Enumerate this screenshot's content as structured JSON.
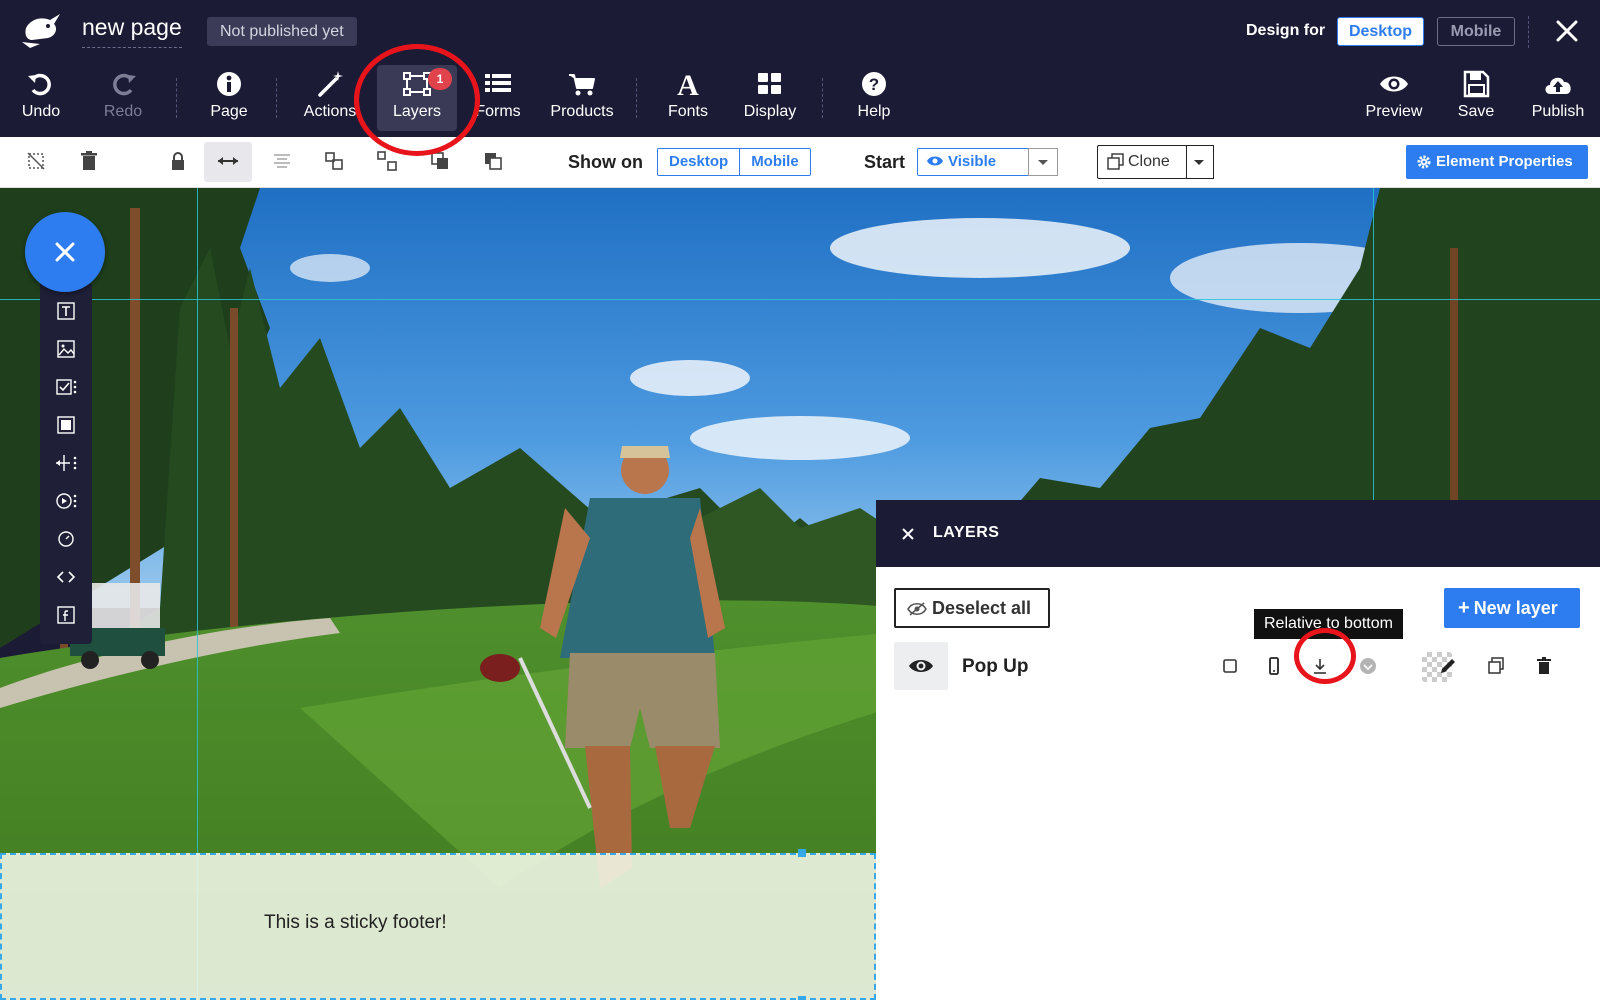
{
  "header": {
    "page_title": "new page",
    "publish_status": "Not published yet",
    "design_for_label": "Design for",
    "design_for_options": [
      "Desktop",
      "Mobile"
    ],
    "design_for_selected": "Desktop"
  },
  "toolbar": {
    "items": [
      {
        "label": "Undo",
        "icon": "undo-icon",
        "enabled": true
      },
      {
        "label": "Redo",
        "icon": "redo-icon",
        "enabled": false
      },
      {
        "label": "Page",
        "icon": "info-icon",
        "enabled": true
      },
      {
        "label": "Actions",
        "icon": "magic-wand-icon",
        "enabled": true
      },
      {
        "label": "Layers",
        "icon": "layers-icon",
        "enabled": true,
        "active": true,
        "badge": "1"
      },
      {
        "label": "Forms",
        "icon": "list-icon",
        "enabled": true
      },
      {
        "label": "Products",
        "icon": "cart-icon",
        "enabled": true
      },
      {
        "label": "Fonts",
        "icon": "font-icon",
        "enabled": true
      },
      {
        "label": "Display",
        "icon": "grid-icon",
        "enabled": true
      },
      {
        "label": "Help",
        "icon": "question-icon",
        "enabled": true
      },
      {
        "label": "Preview",
        "icon": "eye-icon",
        "enabled": true
      },
      {
        "label": "Save",
        "icon": "floppy-icon",
        "enabled": true
      },
      {
        "label": "Publish",
        "icon": "cloud-upload-icon",
        "enabled": true
      }
    ]
  },
  "element_bar": {
    "show_on_label": "Show on",
    "show_on_options": [
      "Desktop",
      "Mobile"
    ],
    "start_label": "Start",
    "start_value": "Visible",
    "clone_label": "Clone",
    "element_properties_label": "Element Properties"
  },
  "canvas": {
    "sticky_footer_text": "This is a sticky footer!"
  },
  "layers_panel": {
    "title": "LAYERS",
    "deselect_label": "Deselect all",
    "new_layer_label": "New layer",
    "tooltip": "Relative to bottom",
    "layers": [
      {
        "name": "Pop Up",
        "visible": true
      }
    ]
  },
  "colors": {
    "dark_bg": "#1b1b35",
    "accent_blue": "#2e7df0",
    "highlight_red": "#e8141c",
    "guide_cyan": "#27c4d6"
  }
}
